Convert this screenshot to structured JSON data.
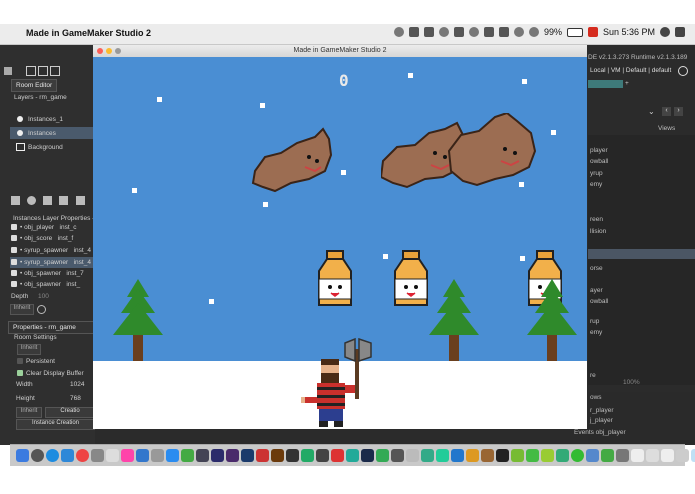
{
  "menubar": {
    "app_name": "Made in GameMaker Studio 2",
    "clock": "Sun 5:36 PM",
    "battery": "99%"
  },
  "ide": {
    "room_editor_tab": "Room Editor",
    "layers_label": "Layers - rm_game",
    "layers": [
      "Instances_1",
      "Instances",
      "Background"
    ],
    "instances_layer_props": "Instances Layer Properties - r",
    "instances": [
      {
        "name": "obj_player",
        "id": "inst_c"
      },
      {
        "name": "obj_score",
        "id": "inst_f"
      },
      {
        "name": "syrup_spawner",
        "id": "inst_4"
      },
      {
        "name": "syrup_spawner",
        "id": "inst_4"
      },
      {
        "name": "obj_spawner",
        "id": "inst_7"
      },
      {
        "name": "obj_spawner",
        "id": "inst_"
      }
    ],
    "depth_label": "Depth",
    "depth_value": "100",
    "inherit_label": "Inherit",
    "properties_label": "Properties - rm_game",
    "room_settings": "Room Settings",
    "persistent": "Persistent",
    "clear_display_buffer": "Clear Display Buffer",
    "width_label": "Width",
    "width_value": "1024",
    "height_label": "Height",
    "height_value": "768",
    "create_btn": "Creatio",
    "instance_creation": "Instance Creation",
    "right_header": "DE v2.1.3.273 Runtime v2.1.3.189",
    "right_nav": "Local | VM | Default | default",
    "views_label": "Views",
    "resources": [
      "player",
      "owball",
      "yrup",
      "emy",
      "reen",
      "llision",
      "orse",
      "ayer",
      "owball",
      "rup",
      "emy",
      "re"
    ],
    "zoom": "100%",
    "bottom_right": [
      "ows",
      "r_player",
      "j_player",
      "Events obj_player"
    ]
  },
  "game": {
    "window_title": "Made in GameMaker Studio 2",
    "score": "0"
  },
  "colors": {
    "sky": "#4a8ed3",
    "ground": "#ffffff",
    "tree": "#2f8a2b",
    "trunk": "#6a3f1e",
    "bear": "#9c6d52",
    "bottle": "#f0a53a"
  }
}
